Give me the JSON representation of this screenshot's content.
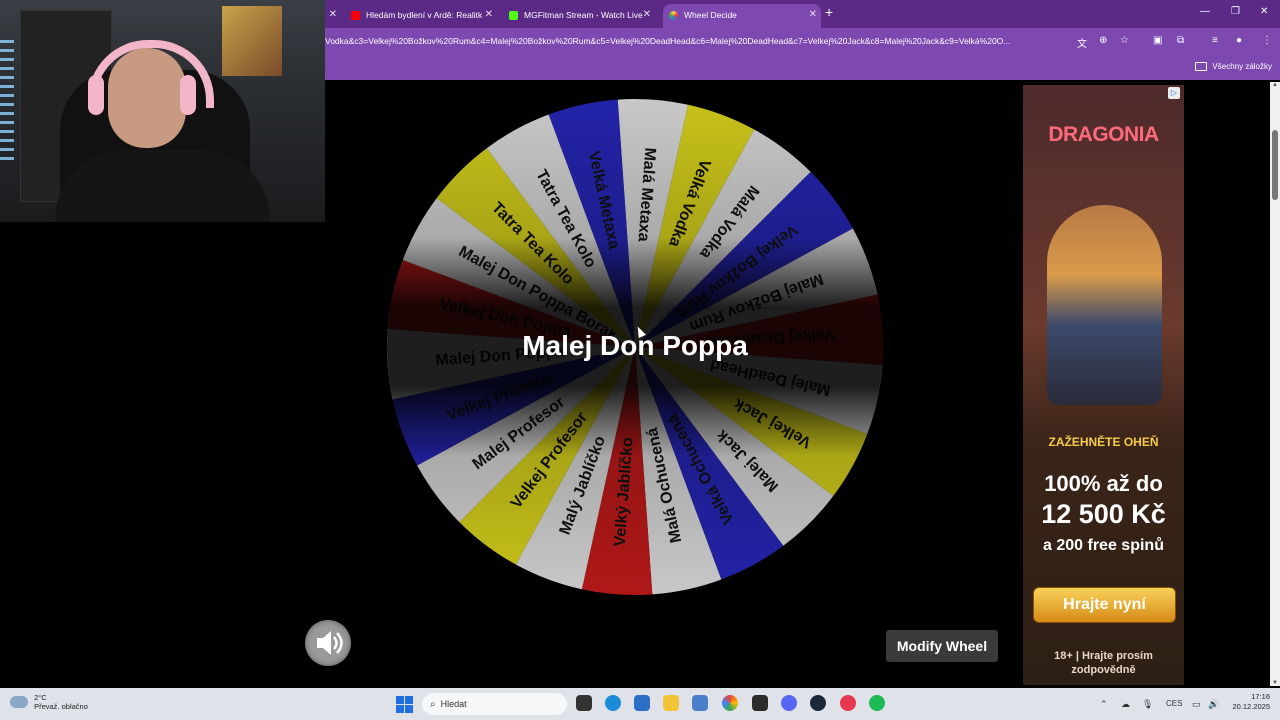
{
  "browser": {
    "tabs": [
      {
        "title": "Hledám bydlení v Ardě: Realitk",
        "icon": "youtube-icon",
        "color": "#ff0000"
      },
      {
        "title": "MGFitman Stream - Watch Live",
        "icon": "kick-icon",
        "color": "#53fc18"
      },
      {
        "title": "Wheel Decide",
        "icon": "wheel-decide-icon",
        "color": "#ffd54a",
        "active": true
      }
    ],
    "url": "Vodka&c3=Velkej%20Božkov%20Rum&c4=Malej%20Božkov%20Rum&c5=Velkej%20DeadHead&c6=Malej%20DeadHead&c7=Velkej%20Jack&c8=Malej%20Jack&c9=Velká%20O...",
    "bookmarks_label": "Všechny záložky",
    "theme_color": "#7d48b0"
  },
  "wheel": {
    "result": "Malej Don Poppa",
    "visible_slices": [
      {
        "label": "Malá Metaxa",
        "color": "#c8c8c8"
      },
      {
        "label": "Velká Vodka",
        "color": "#c7c21a"
      },
      {
        "label": "Malá Vodka",
        "color": "#c8c8c8"
      },
      {
        "label": "Velkej Božkov Rum",
        "color": "#2323a8"
      },
      {
        "label": "Malej Božkov Rum",
        "color": "#c8c8c8"
      },
      {
        "label": "Velkej DeadHead",
        "color": "#b01818"
      },
      {
        "label": "Malej DeadHead",
        "color": "#c8c8c8"
      },
      {
        "label": "Velkej Jack",
        "color": "#c7c21a"
      },
      {
        "label": "Malej Jack",
        "color": "#c8c8c8"
      },
      {
        "label": "Velká Ochucená",
        "color": "#2323a8"
      },
      {
        "label": "Malá Ochucená",
        "color": "#c8c8c8"
      },
      {
        "label": "Velký Jablíčko",
        "color": "#b01818"
      },
      {
        "label": "Malý Jablíčko",
        "color": "#c8c8c8"
      },
      {
        "label": "Velkej Profesor",
        "color": "#c7c21a"
      },
      {
        "label": "Malej Profesor",
        "color": "#c8c8c8"
      },
      {
        "label": "Velkej Profesor",
        "color": "#2323a8"
      },
      {
        "label": "Malej Don Poppa",
        "color": "#c8c8c8"
      },
      {
        "label": "Velkej Don Poppa",
        "color": "#b01818"
      },
      {
        "label": "Malej Don Poppa Borák",
        "color": "#c8c8c8"
      },
      {
        "label": "Tatra Tea Kolo",
        "color": "#c7c21a"
      },
      {
        "label": "Tatra Tea Kolo",
        "color": "#c8c8c8"
      },
      {
        "label": "Velká Metaxa",
        "color": "#2323a8"
      }
    ],
    "sound_icon": "speaker-icon",
    "modify_label": "Modify Wheel"
  },
  "ad": {
    "brand": "DRAGONIA",
    "banner": "ZAŽEHNĚTE OHEŇ",
    "line1": "100% až do",
    "line2": "12 500 Kč",
    "line3": "a 200 free spinů",
    "cta": "Hrajte nyní",
    "disclaimer": "18+ | Hrajte prosím zodpovědně",
    "info_icon": "ad-choices-icon"
  },
  "taskbar": {
    "weather_temp": "2°C",
    "weather_desc": "Převaž. oblačno",
    "search_placeholder": "Hledat",
    "language": "CES",
    "time": "17:16",
    "date": "20.12.2025"
  }
}
